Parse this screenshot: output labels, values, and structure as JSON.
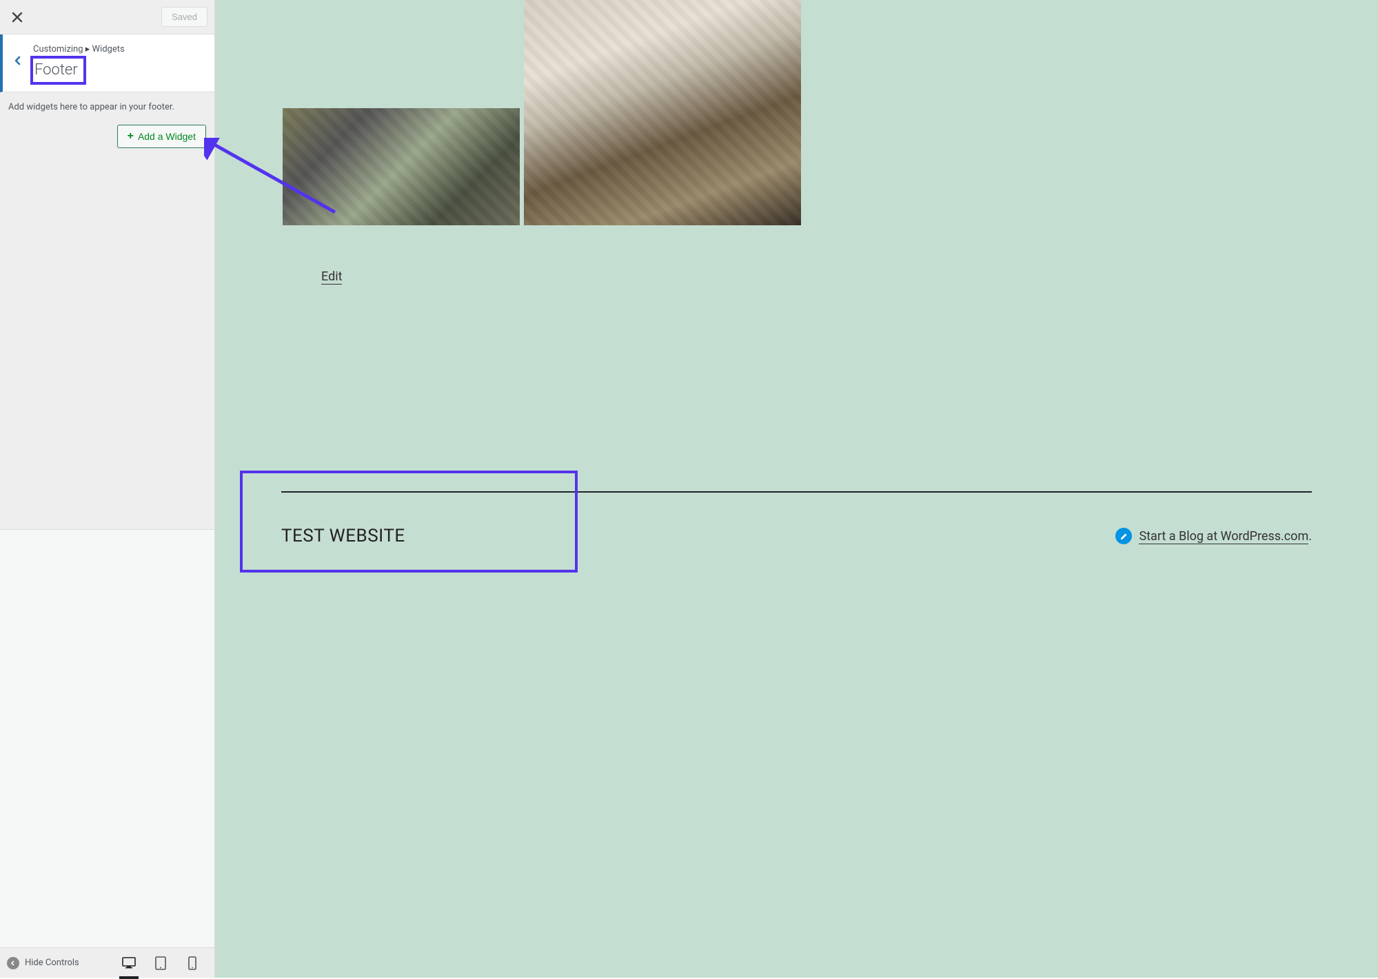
{
  "sidebar": {
    "top": {
      "saved_label": "Saved"
    },
    "breadcrumb": {
      "root": "Customizing",
      "section": "Widgets"
    },
    "title": "Footer",
    "description": "Add widgets here to appear in your footer.",
    "add_widget_label": "Add a Widget"
  },
  "footerBar": {
    "hide_controls_label": "Hide Controls",
    "devices": {
      "active": "desktop"
    }
  },
  "preview": {
    "edit_link": "Edit",
    "footer": {
      "site_title": "TEST WEBSITE",
      "credit_text": "Start a Blog at WordPress.com",
      "credit_suffix": "."
    }
  },
  "colors": {
    "highlight": "#5333ed",
    "accent_green": "#008a20",
    "preview_bg": "#c5ded2"
  }
}
